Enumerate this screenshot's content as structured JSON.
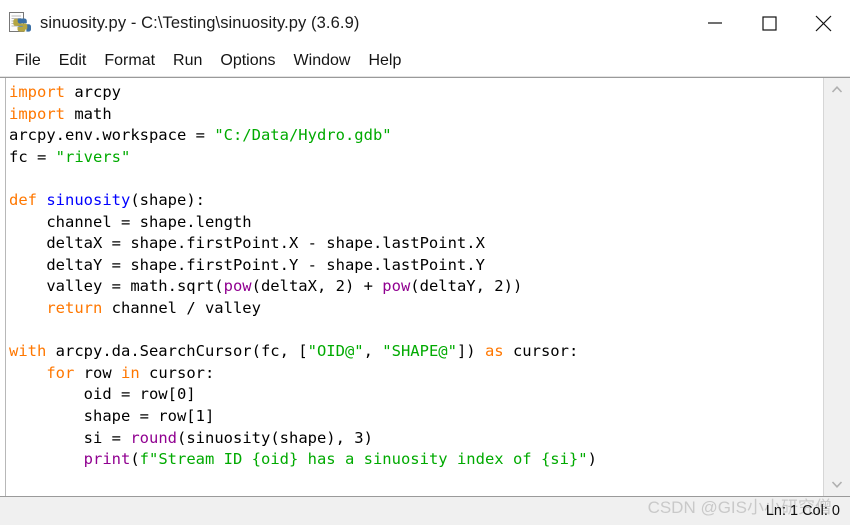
{
  "window": {
    "title": "sinuosity.py - C:\\Testing\\sinuosity.py (3.6.9)",
    "icon": "python-file-icon",
    "controls": {
      "minimize": "minimize-icon",
      "maximize": "maximize-icon",
      "close": "close-icon"
    }
  },
  "menubar": {
    "items": [
      {
        "label": "File"
      },
      {
        "label": "Edit"
      },
      {
        "label": "Format"
      },
      {
        "label": "Run"
      },
      {
        "label": "Options"
      },
      {
        "label": "Window"
      },
      {
        "label": "Help"
      }
    ]
  },
  "editor": {
    "language": "python",
    "lines": [
      [
        {
          "t": "import",
          "c": "kw"
        },
        {
          "t": " arcpy",
          "c": "pl"
        }
      ],
      [
        {
          "t": "import",
          "c": "kw"
        },
        {
          "t": " math",
          "c": "pl"
        }
      ],
      [
        {
          "t": "arcpy.env.workspace = ",
          "c": "pl"
        },
        {
          "t": "\"C:/Data/Hydro.gdb\"",
          "c": "str"
        }
      ],
      [
        {
          "t": "fc = ",
          "c": "pl"
        },
        {
          "t": "\"rivers\"",
          "c": "str"
        }
      ],
      [
        {
          "t": "",
          "c": "pl"
        }
      ],
      [
        {
          "t": "def",
          "c": "kw"
        },
        {
          "t": " ",
          "c": "pl"
        },
        {
          "t": "sinuosity",
          "c": "def"
        },
        {
          "t": "(shape):",
          "c": "pl"
        }
      ],
      [
        {
          "t": "    channel = shape.length",
          "c": "pl"
        }
      ],
      [
        {
          "t": "    deltaX = shape.firstPoint.X - shape.lastPoint.X",
          "c": "pl"
        }
      ],
      [
        {
          "t": "    deltaY = shape.firstPoint.Y - shape.lastPoint.Y",
          "c": "pl"
        }
      ],
      [
        {
          "t": "    valley = math.sqrt(",
          "c": "pl"
        },
        {
          "t": "pow",
          "c": "bi"
        },
        {
          "t": "(deltaX, 2) + ",
          "c": "pl"
        },
        {
          "t": "pow",
          "c": "bi"
        },
        {
          "t": "(deltaY, 2))",
          "c": "pl"
        }
      ],
      [
        {
          "t": "    ",
          "c": "pl"
        },
        {
          "t": "return",
          "c": "kw"
        },
        {
          "t": " channel / valley",
          "c": "pl"
        }
      ],
      [
        {
          "t": "",
          "c": "pl"
        }
      ],
      [
        {
          "t": "with",
          "c": "kw"
        },
        {
          "t": " arcpy.da.SearchCursor(fc, [",
          "c": "pl"
        },
        {
          "t": "\"OID@\"",
          "c": "str"
        },
        {
          "t": ", ",
          "c": "pl"
        },
        {
          "t": "\"SHAPE@\"",
          "c": "str"
        },
        {
          "t": "]) ",
          "c": "pl"
        },
        {
          "t": "as",
          "c": "kw"
        },
        {
          "t": " cursor:",
          "c": "pl"
        }
      ],
      [
        {
          "t": "    ",
          "c": "pl"
        },
        {
          "t": "for",
          "c": "kw"
        },
        {
          "t": " row ",
          "c": "pl"
        },
        {
          "t": "in",
          "c": "kw"
        },
        {
          "t": " cursor:",
          "c": "pl"
        }
      ],
      [
        {
          "t": "        oid = row[0]",
          "c": "pl"
        }
      ],
      [
        {
          "t": "        shape = row[1]",
          "c": "pl"
        }
      ],
      [
        {
          "t": "        si = ",
          "c": "pl"
        },
        {
          "t": "round",
          "c": "bi"
        },
        {
          "t": "(sinuosity(shape), 3)",
          "c": "pl"
        }
      ],
      [
        {
          "t": "        ",
          "c": "pl"
        },
        {
          "t": "print",
          "c": "bi"
        },
        {
          "t": "(",
          "c": "pl"
        },
        {
          "t": "f\"Stream ID {oid} has a sinuosity index of {si}\"",
          "c": "str"
        },
        {
          "t": ")",
          "c": "pl"
        }
      ]
    ],
    "plain_text": "import arcpy\nimport math\narcpy.env.workspace = \"C:/Data/Hydro.gdb\"\nfc = \"rivers\"\n\ndef sinuosity(shape):\n    channel = shape.length\n    deltaX = shape.firstPoint.X - shape.lastPoint.X\n    deltaY = shape.firstPoint.Y - shape.lastPoint.Y\n    valley = math.sqrt(pow(deltaX, 2) + pow(deltaY, 2))\n    return channel / valley\n\nwith arcpy.da.SearchCursor(fc, [\"OID@\", \"SHAPE@\"]) as cursor:\n    for row in cursor:\n        oid = row[0]\n        shape = row[1]\n        si = round(sinuosity(shape), 3)\n        print(f\"Stream ID {oid} has a sinuosity index of {si}\")"
  },
  "scrollbar": {
    "up_arrow": "chevron-up-icon",
    "down_arrow": "chevron-down-icon"
  },
  "statusbar": {
    "position": "Ln: 1 Col: 0",
    "watermark": "CSDN @GIS小小研究僧"
  },
  "colors": {
    "keyword": "#ff7700",
    "string": "#00aa00",
    "definition": "#0000ff",
    "builtin": "#900090",
    "text": "#000000",
    "editor_bg": "#ffffff",
    "chrome_bg": "#f0f0f0"
  }
}
